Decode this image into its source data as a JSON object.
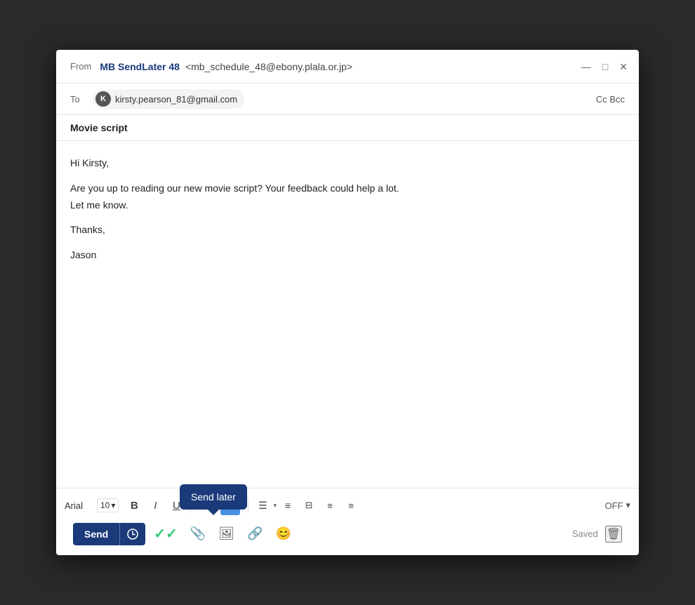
{
  "window": {
    "title_bar": {
      "from_label": "From",
      "sender_name": "MB SendLater 48",
      "sender_email": "<mb_schedule_48@ebony.plala.or.jp>",
      "controls": {
        "minimize": "—",
        "maximize": "□",
        "close": "✕"
      }
    },
    "to_row": {
      "to_label": "To",
      "recipient_initial": "K",
      "recipient_email": "kirsty.pearson_81@gmail.com",
      "cc_bcc": "Cc Bcc"
    },
    "subject": "Movie script",
    "body": {
      "greeting": "Hi Kirsty,",
      "paragraph1": "Are you up to reading our new movie script? Your feedback could help a lot.",
      "paragraph2": "Let me know.",
      "closing": "Thanks,",
      "signature": "Jason"
    },
    "toolbar": {
      "font_name": "Arial",
      "font_size": "10",
      "bold": "B",
      "italic": "I",
      "underline": "U",
      "off_label": "OFF",
      "saved_label": "Saved"
    },
    "send_button": {
      "label": "Send",
      "tooltip": "Send later"
    }
  }
}
